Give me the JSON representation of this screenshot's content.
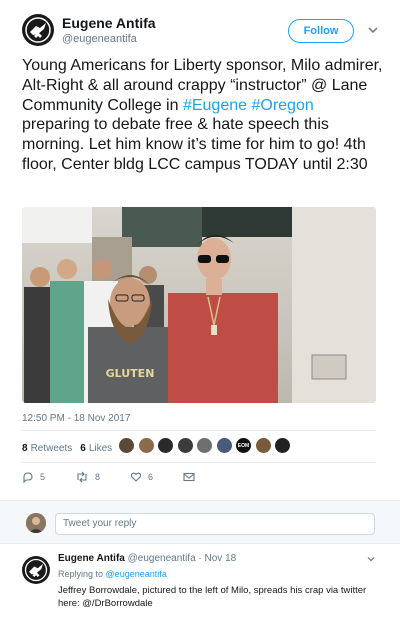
{
  "tweet": {
    "author_name": "Eugene Antifa",
    "author_handle": "@eugeneantifa",
    "follow_label": "Follow",
    "text_parts": {
      "p1": "Young Americans for Liberty sponsor, Milo admirer, Alt-Right & all around crappy “instructor” @ Lane Community College in ",
      "tag1": "#Eugene",
      "space": " ",
      "tag2": "#Oregon",
      "p2": " preparing to debate free & hate speech this morning. Let him know it’s time for him to go! 4th floor,  Center bldg LCC campus TODAY until 2:30"
    },
    "photo_text": "GLUTEN",
    "timestamp": "12:50 PM - 18 Nov 2017",
    "retweets_count": "8",
    "retweets_label": "Retweets",
    "likes_count": "6",
    "likes_label": "Likes",
    "likers": [
      {
        "color": "#5a4a3a",
        "label": ""
      },
      {
        "color": "#8b6b4a",
        "label": ""
      },
      {
        "color": "#2a2a2a",
        "label": ""
      },
      {
        "color": "#3b3b3b",
        "label": ""
      },
      {
        "color": "#6f6f6f",
        "label": ""
      },
      {
        "color": "#4a5a7a",
        "label": ""
      },
      {
        "color": "#111111",
        "label": "EOM"
      },
      {
        "color": "#7a5a3a",
        "label": ""
      },
      {
        "color": "#222222",
        "label": ""
      }
    ],
    "actions": {
      "reply_count": "5",
      "retweet_count": "8",
      "like_count": "6"
    }
  },
  "reply_composer": {
    "placeholder": "Tweet your reply"
  },
  "reply": {
    "author_name": "Eugene Antifa",
    "meta": "@eugeneantifa · Nov 18",
    "replying_prefix": "Replying to",
    "replying_to": "@eugeneantifa",
    "text": "Jeffrey Borrowdale, pictured to the left of Milo, spreads his crap via twitter here: @/DrBorrowdale"
  },
  "colors": {
    "accent": "#1da1f2",
    "secondary_text": "#657786",
    "divider": "#e6ecf0"
  }
}
